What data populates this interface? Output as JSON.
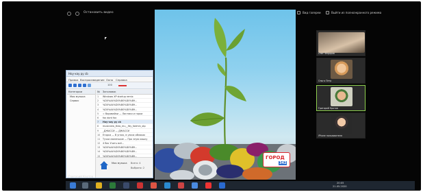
{
  "meeting": {
    "toolbar_label": "Остановить видео",
    "top_right": {
      "view_label": "Вид галереи",
      "fullscreen_label": "Выйти из полноэкранного режима"
    },
    "host_label": "Григорий Кротов"
  },
  "participants": [
    {
      "name": "Олег Федоров"
    },
    {
      "name": "Ольга Петр"
    },
    {
      "name": "Григорий Кротов"
    },
    {
      "name": "iPhone пользователя"
    }
  ],
  "player": {
    "title": "Ноу-хау ру сb",
    "menu": [
      "Правка",
      "Воспроизведение",
      "Окно",
      "Справка"
    ],
    "controls": {
      "volume": "100"
    },
    "left_header": "Категории",
    "left_items": [
      "Моя музыка",
      "Сервис"
    ],
    "list_header": {
      "num": "№",
      "title": "Заголовок"
    },
    "tracks": [
      {
        "n": "1",
        "title": "Windows XP startup remix"
      },
      {
        "n": "2",
        "title": "%D0%A4%D0%B0%D0%B9..."
      },
      {
        "n": "3",
        "title": "%D0%A4%D0%B0%D0%B9..."
      },
      {
        "n": "4",
        "title": "%D0%A4%D0%B0%D0%B9..."
      },
      {
        "n": "5",
        "title": "= Воровайки — Листики и горки"
      },
      {
        "n": "6",
        "title": "fox dont fox"
      },
      {
        "n": "7",
        "title": "Ноу-хау ру сb"
      },
      {
        "n": "8",
        "title": "musicnew_theo_mu__fdy_fadmin_stp"
      },
      {
        "n": "9",
        "title": "_ДЖАССИ — ДЖАССИ"
      },
      {
        "n": "10",
        "title": "Егорка — В углах, в узких облаках"
      },
      {
        "n": "11",
        "title": "Тучки маленькие — Про злую кошку"
      },
      {
        "n": "12",
        "title": "4 Вас Учить всё..."
      },
      {
        "n": "13",
        "title": "%D0%A4%D0%B0%D0%B9..."
      },
      {
        "n": "14",
        "title": "%D0%A4%D0%B0%D0%B9..."
      },
      {
        "n": "15",
        "title": "%D0%A4%D0%B0%D0%B9..."
      }
    ],
    "selected_index": 6,
    "footer": {
      "library": "Моя музыка",
      "count": "Всего: 4",
      "selected": "Выбрано: 2"
    }
  },
  "shared_screen": {
    "badge_text": "ГОРОД",
    "badge_number": "342"
  },
  "taskbar": {
    "time": "20:05",
    "date": "21.05.2020"
  },
  "colors": {
    "screen_bg": "#050505",
    "sky_top": "#6ec3ea",
    "active_tile_border": "#8fd14f",
    "player_accent": "#2f6fd0",
    "badge_bg": "#d9262b"
  }
}
